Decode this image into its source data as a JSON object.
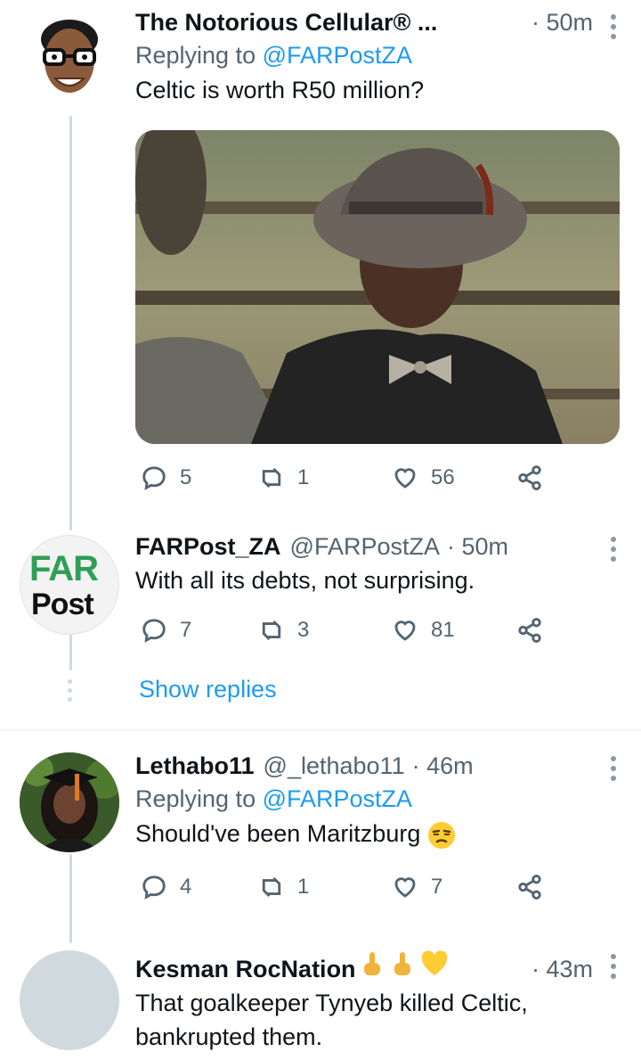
{
  "tweets": [
    {
      "name": "The Notorious Cellular® ...",
      "handle": "",
      "time": "· 50m",
      "replying_prefix": "Replying to",
      "replying_handle": "@FARPostZA",
      "text": "Celtic is worth R50 million?",
      "replies": "5",
      "retweets": "1",
      "likes": "56"
    },
    {
      "name": "FARPost_ZA",
      "handle": "@FARPostZA",
      "time": "· 50m",
      "text": "With all its debts, not surprising.",
      "replies": "7",
      "retweets": "3",
      "likes": "81",
      "avatar_text_top": "FAR",
      "avatar_text_bottom": "Post"
    },
    {
      "name": "Lethabo11",
      "handle": "@_lethabo11",
      "time": "· 46m",
      "replying_prefix": "Replying to",
      "replying_handle": "@FARPostZA",
      "text": "Should've been Maritzburg",
      "replies": "4",
      "retweets": "1",
      "likes": "7"
    },
    {
      "name": "Kesman RocNation",
      "time": "· 43m",
      "text_line1": "That goalkeeper Tynyeb killed Celtic,",
      "text_line2": "bankrupted them."
    }
  ],
  "show_replies_label": "Show replies",
  "colors": {
    "link": "#1d9bf0",
    "secondary": "#536471",
    "thread_line": "#cfd9de"
  },
  "icons": {
    "reply": "reply-icon",
    "retweet": "retweet-icon",
    "like": "heart-icon",
    "share": "share-icon",
    "more": "more-vertical-icon"
  }
}
